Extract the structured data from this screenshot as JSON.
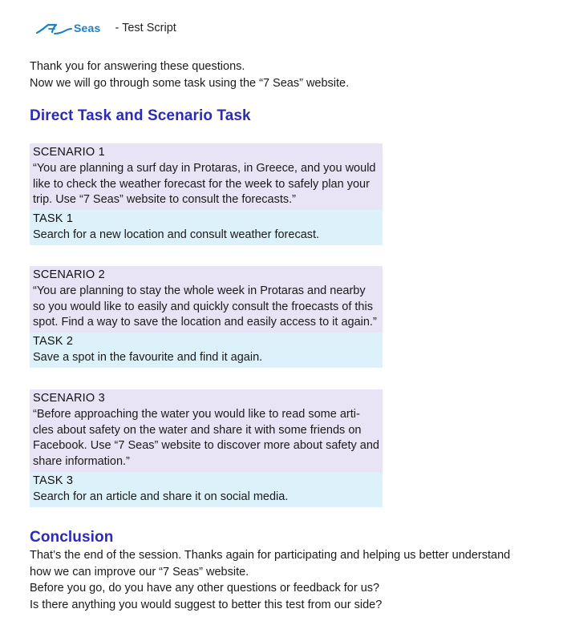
{
  "header": {
    "logo_text": "Seas",
    "logo_icon": "wave-7-icon",
    "brand_color": "#1d7fc4",
    "subtitle": "- Test Script"
  },
  "intro": {
    "line1": "Thank you for answering these questions.",
    "line2": "Now we will go through some task using the “7 Seas” website."
  },
  "section_title": "Direct Task and Scenario Task",
  "blocks": [
    {
      "scenario_label": "SCENARIO 1",
      "scenario_lines": [
        "“You are planning a surf day in Protaras, in Greece, and you would",
        "like to check the weather forecast for the week to safely plan your",
        "trip. Use “7 Seas” website to consult the forecasts.”"
      ],
      "task_label": "TASK 1",
      "task_text": "Search for a new location and consult weather forecast."
    },
    {
      "scenario_label": "SCENARIO 2",
      "scenario_lines": [
        "“You are planning to stay the whole week in Protaras and nearby",
        "so you would like to easily and quickly consult the froecasts of this",
        "spot. Find a way to save the location and easily access to it again.”"
      ],
      "task_label": "TASK 2",
      "task_text": "Save a spot in the favourite and find it again."
    },
    {
      "scenario_label": "SCENARIO 3",
      "scenario_lines": [
        "“Before approaching the water you would like to read some arti-",
        "cles about safety on the water and share it with some friends on",
        "Facebook. Use “7 Seas” website to discover more about safety and",
        "share information.”"
      ],
      "task_label": "TASK 3",
      "task_text": "Search for an article and share it on social media."
    }
  ],
  "conclusion": {
    "title": "Conclusion",
    "line1": "That’s the end of the session. Thanks again for participating and helping us better understand",
    "line2": "how we can improve our “7 Seas” website.",
    "line3": "Before you go, do you have any other questions or feedback for us?",
    "line4": "Is there anything you would suggest to better this test from our side?"
  },
  "colors": {
    "heading": "#2b2bb8",
    "scenario_bg": "#e8e4f6",
    "task_bg": "#ddf1fb"
  }
}
